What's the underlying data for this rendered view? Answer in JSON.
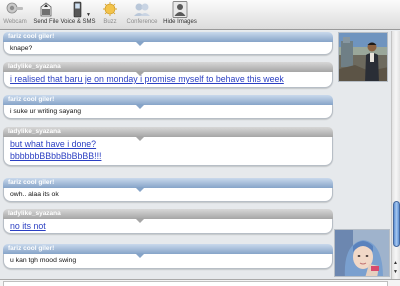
{
  "toolbar": {
    "items": [
      {
        "label": "Webcam",
        "icon": "webcam-icon",
        "enabled": false
      },
      {
        "label": "Send File",
        "icon": "send-file-icon",
        "enabled": true
      },
      {
        "label": "Voice & SMS",
        "icon": "voice-sms-icon",
        "enabled": true
      },
      {
        "label": "Buzz",
        "icon": "buzz-icon",
        "enabled": false
      },
      {
        "label": "Conference",
        "icon": "conference-icon",
        "enabled": false
      },
      {
        "label": "Hide Images",
        "icon": "hide-images-icon",
        "enabled": true
      }
    ]
  },
  "messages": [
    {
      "sender": "fariz cool giler!",
      "text": "knape?"
    },
    {
      "sender": "ladylike_syazana",
      "text": "i realised that baru je on monday i promise myself to behave this week"
    },
    {
      "sender": "fariz cool giler!",
      "text": "i suke ur writing sayang"
    },
    {
      "sender": "ladylike_syazana",
      "line1": "but what have i done?",
      "line2": "bbbbbbBBbbBbBbBB!!!"
    },
    {
      "sender": "fariz cool giler!",
      "text": "owh.. alaa its ok"
    },
    {
      "sender": "ladylike_syazana",
      "text": "no its not"
    },
    {
      "sender": "fariz cool giler!",
      "text": "u kan tgh mood swing"
    }
  ],
  "colors": {
    "my_header": "#86a4c8",
    "their_header": "#a6a6a6",
    "big_text": "#2b3fc2"
  }
}
